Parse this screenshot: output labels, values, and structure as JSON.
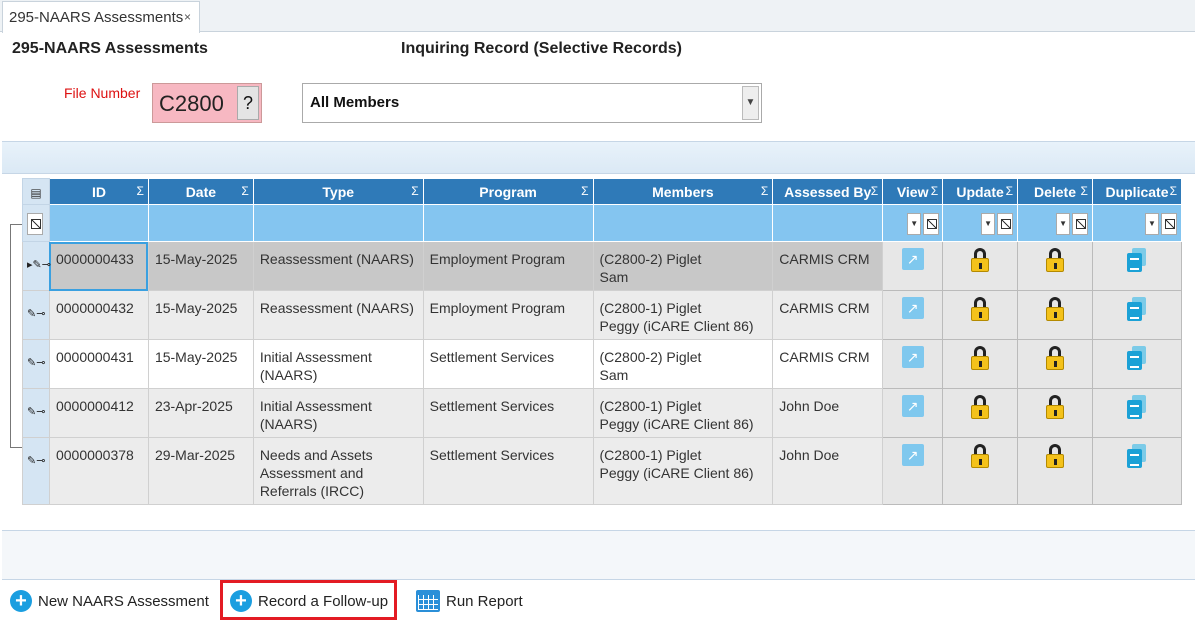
{
  "tab": {
    "label": "295-NAARS Assessments",
    "close": "×"
  },
  "header": {
    "title": "295-NAARS Assessments",
    "mode": "Inquiring Record (Selective Records)"
  },
  "file_number": {
    "label": "File Number",
    "value": "C2800",
    "help": "?"
  },
  "members_select": {
    "value": "All Members"
  },
  "grid": {
    "columns": [
      "ID",
      "Date",
      "Type",
      "Program",
      "Members",
      "Assessed By",
      "View",
      "Update",
      "Delete",
      "Duplicate"
    ],
    "sigma": "Σ",
    "rows": [
      {
        "id": "0000000433",
        "date": "15-May-2025",
        "type": "Reassessment (NAARS)",
        "program": "Employment Program",
        "members": "(C2800-2) Piglet\nSam",
        "assessed_by": "CARMIS CRM"
      },
      {
        "id": "0000000432",
        "date": "15-May-2025",
        "type": "Reassessment (NAARS)",
        "program": "Employment Program",
        "members": "(C2800-1) Piglet\nPeggy (iCARE Client 86)",
        "assessed_by": "CARMIS CRM"
      },
      {
        "id": "0000000431",
        "date": "15-May-2025",
        "type": "Initial Assessment\n(NAARS)",
        "program": "Settlement Services",
        "members": "(C2800-2) Piglet\nSam",
        "assessed_by": "CARMIS CRM"
      },
      {
        "id": "0000000412",
        "date": "23-Apr-2025",
        "type": "Initial Assessment\n(NAARS)",
        "program": "Settlement Services",
        "members": "(C2800-1) Piglet\nPeggy (iCARE Client 86)",
        "assessed_by": "John Doe"
      },
      {
        "id": "0000000378",
        "date": "29-Mar-2025",
        "type": "Needs and Assets\nAssessment and\nReferrals (IRCC)",
        "program": "Settlement Services",
        "members": "(C2800-1) Piglet\nPeggy (iCARE Client 86)",
        "assessed_by": "John Doe"
      }
    ]
  },
  "bottom": {
    "new_label": "New NAARS Assessment",
    "followup_label": "Record a Follow-up",
    "report_label": "Run Report"
  },
  "colors": {
    "header_blue": "#2f7ab8",
    "filter_blue": "#84c5f0",
    "file_pink": "#f7b8c2",
    "highlight_red": "#e31b23"
  }
}
